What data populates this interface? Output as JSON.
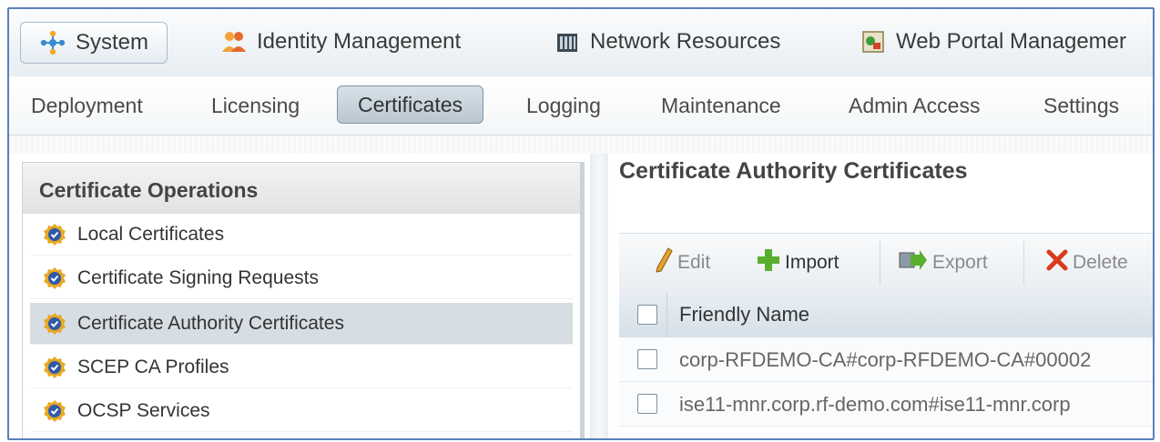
{
  "top_tabs": [
    {
      "label": "System",
      "icon": "system-icon",
      "active": true
    },
    {
      "label": "Identity Management",
      "icon": "users-icon",
      "active": false
    },
    {
      "label": "Network Resources",
      "icon": "network-device-icon",
      "active": false
    },
    {
      "label": "Web Portal Managemer",
      "icon": "web-portal-icon",
      "active": false
    }
  ],
  "sub_tabs": [
    {
      "label": "Deployment"
    },
    {
      "label": "Licensing"
    },
    {
      "label": "Certificates",
      "active": true
    },
    {
      "label": "Logging"
    },
    {
      "label": "Maintenance"
    },
    {
      "label": "Admin Access"
    },
    {
      "label": "Settings"
    }
  ],
  "left_panel": {
    "title": "Certificate Operations",
    "items": [
      {
        "label": "Local Certificates"
      },
      {
        "label": "Certificate Signing Requests"
      },
      {
        "label": "Certificate Authority Certificates",
        "selected": true
      },
      {
        "label": "SCEP CA Profiles"
      },
      {
        "label": "OCSP Services"
      }
    ]
  },
  "main": {
    "title": "Certificate Authority Certificates",
    "toolbar": {
      "edit": "Edit",
      "import": "Import",
      "export": "Export",
      "delete": "Delete"
    },
    "table": {
      "column_header": "Friendly Name",
      "rows": [
        {
          "name": "corp-RFDEMO-CA#corp-RFDEMO-CA#00002"
        },
        {
          "name": "ise11-mnr.corp.rf-demo.com#ise11-mnr.corp"
        }
      ]
    }
  },
  "colors": {
    "frame_border": "#5b7fb8",
    "selected_row": "#d6dde3",
    "active_subtab": "#c2ced8",
    "delete_red": "#d93a1e",
    "import_green": "#5aae2e"
  }
}
